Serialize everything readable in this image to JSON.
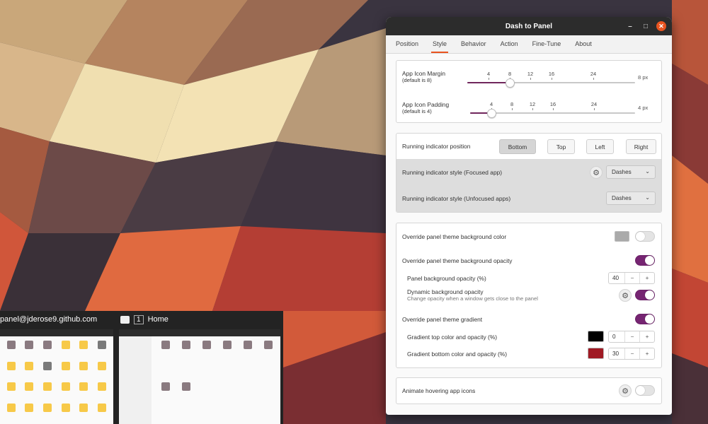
{
  "colors": {
    "accent": "#e95420",
    "switch_on": "#762572",
    "slider_fill": "#70265c",
    "gradient_top": "#000000",
    "gradient_bottom": "#a01a24",
    "panel_bg_color": "#aaaaaa"
  },
  "previews": [
    {
      "title": "panel@jderose9.github.com",
      "icon": "folder-icon"
    },
    {
      "workspace": "1",
      "title": "Home",
      "icon": "folder-icon"
    }
  ],
  "window": {
    "title": "Dash to Panel",
    "controls": {
      "minimize": "–",
      "maximize": "□",
      "close": "✕"
    }
  },
  "tabs": [
    "Position",
    "Style",
    "Behavior",
    "Action",
    "Fine-Tune",
    "About"
  ],
  "active_tab": "Style",
  "icon_margin": {
    "label": "App Icon Margin",
    "sublabel": "(default is 8)",
    "marks": [
      "4",
      "8",
      "12",
      "16",
      "24"
    ],
    "value": 8,
    "unit": "8 px"
  },
  "icon_padding": {
    "label": "App Icon Padding",
    "sublabel": "(default is 4)",
    "marks": [
      "4",
      "8",
      "12",
      "16",
      "24"
    ],
    "value": 4,
    "unit": "4 px"
  },
  "running_indicator": {
    "position_label": "Running indicator position",
    "positions": [
      "Bottom",
      "Top",
      "Left",
      "Right"
    ],
    "selected": "Bottom",
    "focused_label": "Running indicator style (Focused app)",
    "focused_value": "Dashes",
    "unfocused_label": "Running indicator style (Unfocused apps)",
    "unfocused_value": "Dashes"
  },
  "override": {
    "bg_color_label": "Override panel theme background color",
    "bg_color_on": false,
    "bg_opacity_label": "Override panel theme background opacity",
    "bg_opacity_on": true,
    "panel_opacity_label": "Panel background opacity (%)",
    "panel_opacity_value": "40",
    "dynamic_label": "Dynamic background opacity",
    "dynamic_sublabel": "Change opacity when a window gets close to the panel",
    "dynamic_on": true,
    "gradient_label": "Override panel theme gradient",
    "gradient_on": true,
    "gradient_top_label": "Gradient top color and opacity (%)",
    "gradient_top_value": "0",
    "gradient_bottom_label": "Gradient bottom color and opacity (%)",
    "gradient_bottom_value": "30"
  },
  "animate": {
    "label": "Animate hovering app icons",
    "on": false
  },
  "spin": {
    "minus": "−",
    "plus": "+"
  },
  "gear_glyph": "⚙",
  "chevron_glyph": "⌄"
}
